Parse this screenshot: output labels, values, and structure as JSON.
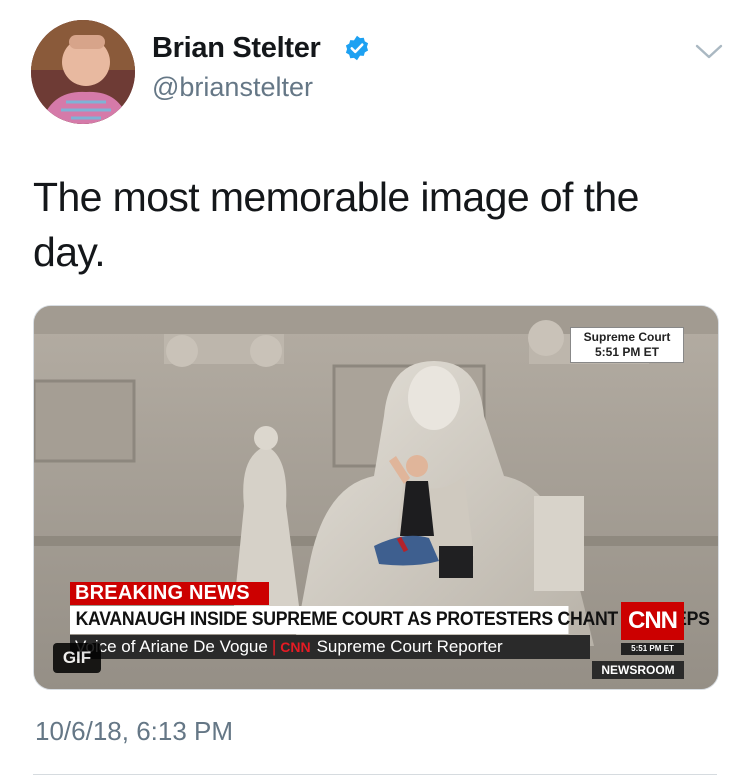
{
  "author": {
    "display_name": "Brian Stelter",
    "handle": "@brianstelter",
    "verified": true,
    "avatar_icon": "avatar"
  },
  "tweet": {
    "text": "The most memorable image of the day.",
    "timestamp": "10/6/18, 6:13 PM"
  },
  "media": {
    "type": "GIF",
    "badge": "GIF",
    "location_label": "Supreme Court",
    "location_time": "5:51 PM ET",
    "breaking_label": "BREAKING NEWS",
    "headline": "KAVANAUGH INSIDE SUPREME COURT AS PROTESTERS CHANT ON STEPS",
    "subline_voice": "Voice of Ariane De Vogue",
    "subline_network": "CNN",
    "subline_role": "Supreme Court Reporter",
    "network_logo": "CNN",
    "network_time": "5:51 PM ET",
    "show_name": "NEWSROOM"
  },
  "colors": {
    "cnn_red": "#cc0000",
    "verified_blue": "#1da1f2",
    "secondary_text": "#657786"
  }
}
